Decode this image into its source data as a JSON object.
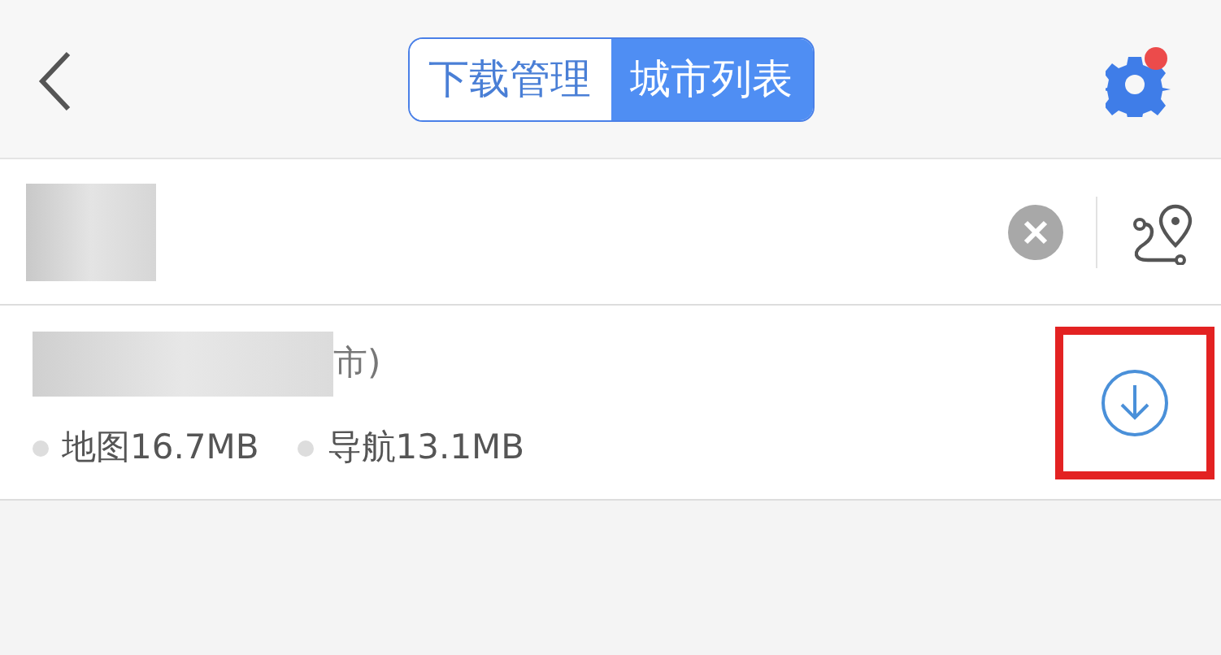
{
  "header": {
    "tabs": [
      {
        "label": "下载管理",
        "selected": false
      },
      {
        "label": "城市列表",
        "selected": true
      }
    ],
    "settings_badge": true
  },
  "search": {
    "has_value": true
  },
  "cities": [
    {
      "name_visible": "市)",
      "sizes": [
        {
          "label": "地图16.7MB"
        },
        {
          "label": "导航13.1MB"
        }
      ],
      "highlighted": true
    }
  ]
}
